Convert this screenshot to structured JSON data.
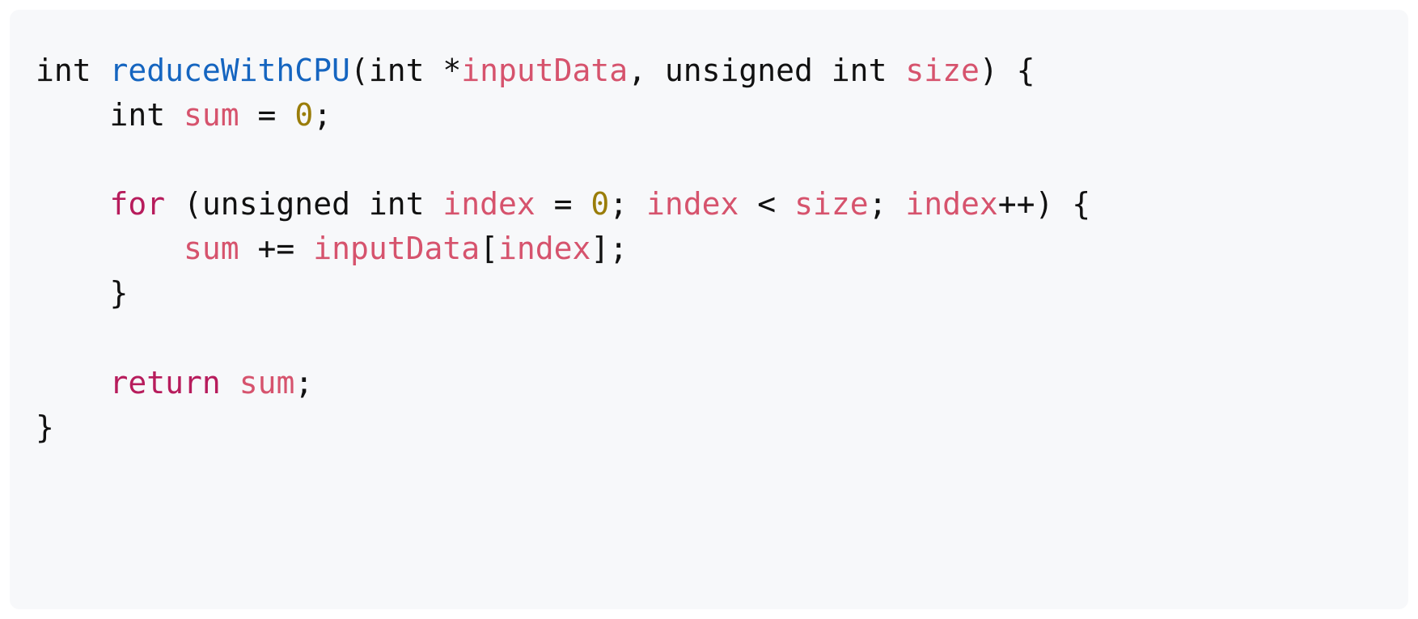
{
  "code": {
    "lang": "c",
    "tokens": [
      [
        {
          "t": "int ",
          "c": "tok-type"
        },
        {
          "t": "reduceWithCPU",
          "c": "tok-func"
        },
        {
          "t": "(",
          "c": "tok"
        },
        {
          "t": "int ",
          "c": "tok-type"
        },
        {
          "t": "*",
          "c": "tok"
        },
        {
          "t": "inputData",
          "c": "tok-var"
        },
        {
          "t": ", ",
          "c": "tok"
        },
        {
          "t": "unsigned int ",
          "c": "tok-type"
        },
        {
          "t": "size",
          "c": "tok-var"
        },
        {
          "t": ") {",
          "c": "tok"
        }
      ],
      [
        {
          "t": "    ",
          "c": "tok"
        },
        {
          "t": "int ",
          "c": "tok-type"
        },
        {
          "t": "sum",
          "c": "tok-var"
        },
        {
          "t": " = ",
          "c": "tok"
        },
        {
          "t": "0",
          "c": "tok-num"
        },
        {
          "t": ";",
          "c": "tok"
        }
      ],
      [
        {
          "t": "",
          "c": "tok"
        }
      ],
      [
        {
          "t": "    ",
          "c": "tok"
        },
        {
          "t": "for",
          "c": "tok-kw"
        },
        {
          "t": " (",
          "c": "tok"
        },
        {
          "t": "unsigned int ",
          "c": "tok-type"
        },
        {
          "t": "index",
          "c": "tok-var"
        },
        {
          "t": " = ",
          "c": "tok"
        },
        {
          "t": "0",
          "c": "tok-num"
        },
        {
          "t": "; ",
          "c": "tok"
        },
        {
          "t": "index",
          "c": "tok-var"
        },
        {
          "t": " < ",
          "c": "tok"
        },
        {
          "t": "size",
          "c": "tok-var"
        },
        {
          "t": "; ",
          "c": "tok"
        },
        {
          "t": "index",
          "c": "tok-var"
        },
        {
          "t": "++) {",
          "c": "tok"
        }
      ],
      [
        {
          "t": "        ",
          "c": "tok"
        },
        {
          "t": "sum",
          "c": "tok-var"
        },
        {
          "t": " += ",
          "c": "tok"
        },
        {
          "t": "inputData",
          "c": "tok-var"
        },
        {
          "t": "[",
          "c": "tok"
        },
        {
          "t": "index",
          "c": "tok-var"
        },
        {
          "t": "];",
          "c": "tok"
        }
      ],
      [
        {
          "t": "    }",
          "c": "tok"
        }
      ],
      [
        {
          "t": "",
          "c": "tok"
        }
      ],
      [
        {
          "t": "    ",
          "c": "tok"
        },
        {
          "t": "return",
          "c": "tok-kw"
        },
        {
          "t": " ",
          "c": "tok"
        },
        {
          "t": "sum",
          "c": "tok-var"
        },
        {
          "t": ";",
          "c": "tok"
        }
      ],
      [
        {
          "t": "}",
          "c": "tok"
        }
      ]
    ]
  }
}
